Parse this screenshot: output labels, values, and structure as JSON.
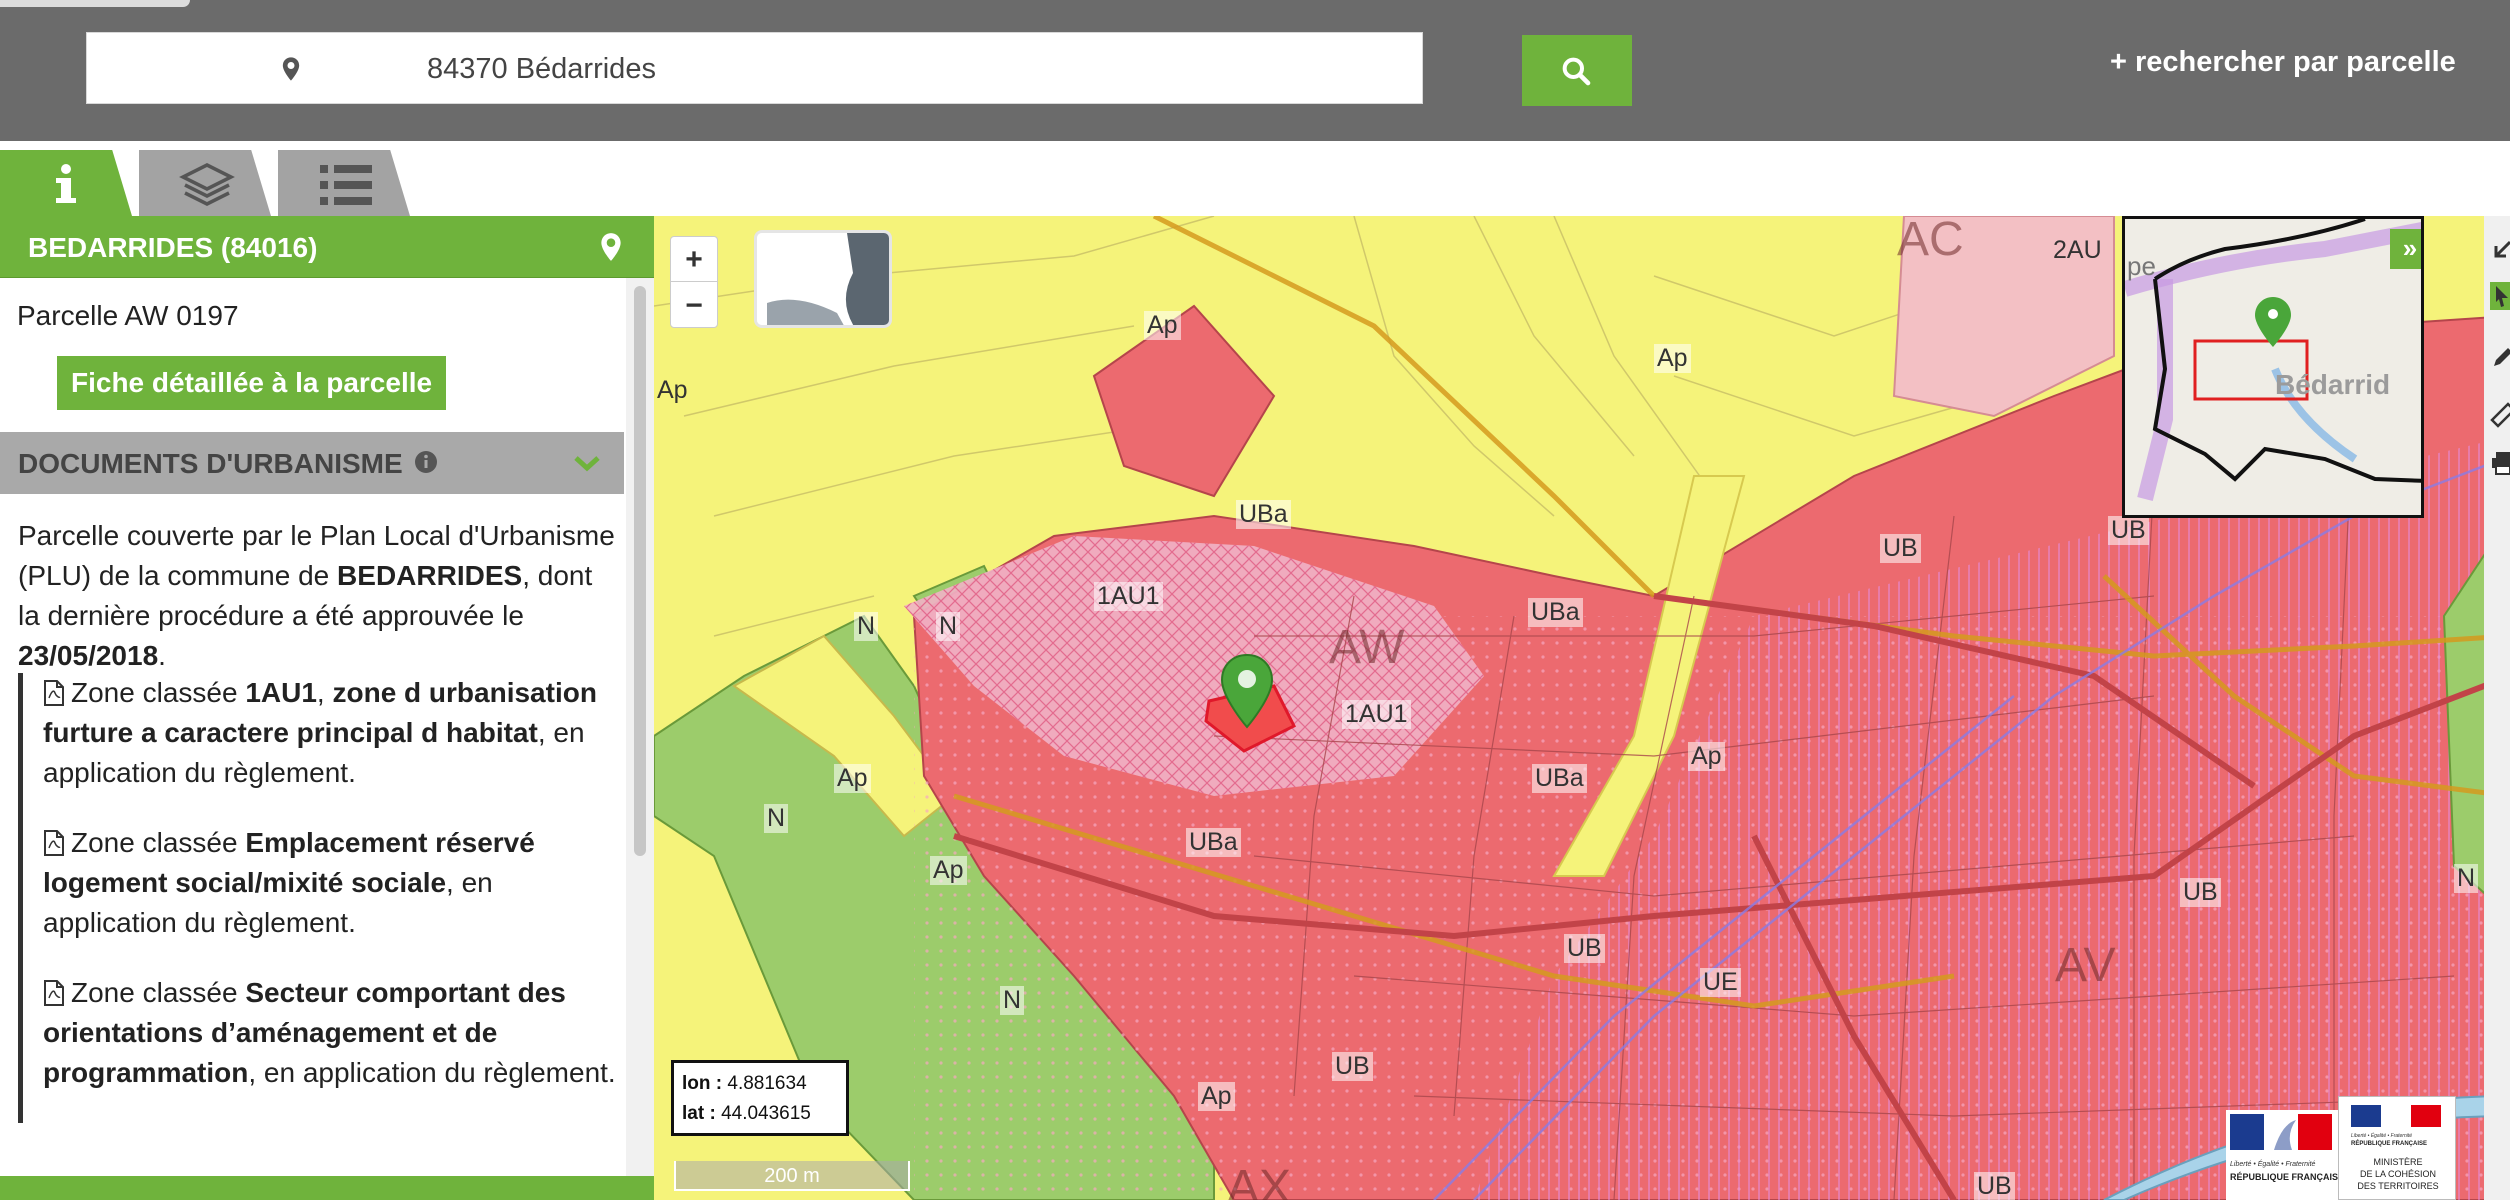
{
  "search": {
    "value": "84370 Bédarrides",
    "parcel_search_label": "+ rechercher par parcelle",
    "pin_icon": "map-marker",
    "button_icon": "magnifier"
  },
  "tabs": [
    {
      "name": "info",
      "icon": "info-i",
      "active": true
    },
    {
      "name": "layers",
      "icon": "layers-stack",
      "active": false
    },
    {
      "name": "legend",
      "icon": "list-lines",
      "active": false
    }
  ],
  "panel": {
    "commune_title": "BEDARRIDES (84016)",
    "parcel_id": "Parcelle AW 0197",
    "detail_button": "Fiche détaillée à la parcelle",
    "docs_title": "DOCUMENTS D'URBANISME",
    "intro": {
      "part1": "Parcelle couverte par le Plan Local d'Urbanisme (PLU) de la commune de ",
      "commune": "BEDARRIDES",
      "part2": ", dont la dernière procédure a été approuvée le ",
      "date": "23/05/2018",
      "part3": "."
    },
    "zones": [
      {
        "prefix": "Zone classée ",
        "name": "1AU1",
        "mid": ", ",
        "bold2": "zone d urbanisation furture a caractere principal d habitat",
        "suffix": ", en application du règlement."
      },
      {
        "prefix": "Zone classée ",
        "name": "Emplacement réservé logement social/mixité sociale",
        "mid": "",
        "bold2": "",
        "suffix": ", en application du règlement."
      },
      {
        "prefix": "Zone classée ",
        "name": "Secteur comportant des orientations d’aménagement et de programmation",
        "mid": "",
        "bold2": "",
        "suffix": ", en application du règlement."
      }
    ]
  },
  "map": {
    "zoom_in": "+",
    "zoom_out": "−",
    "coords": {
      "lon_label": "lon :",
      "lon": "4.881634",
      "lat_label": "lat :",
      "lat": "44.043615"
    },
    "scale": "200 m",
    "minimap_toggle": "»",
    "minimap_town": "Bédarrid",
    "minimap_label_pe": "pe",
    "labels": {
      "ap1": "Ap",
      "ap2": "Ap",
      "ap3": "Ap",
      "ap4": "Ap",
      "ap5": "Ap",
      "ap6": "Ap",
      "ap7": "Ap",
      "uba1": "UBa",
      "uba2": "UBa",
      "uba3": "UBa",
      "uba4": "UBa",
      "au1a": "1AU1",
      "au1b": "1AU1",
      "aw": "AW",
      "av": "AV",
      "ax": "AX",
      "ac": "AC",
      "n1": "N",
      "n2": "N",
      "n3": "N",
      "n4": "N",
      "n5": "N",
      "ub1": "UB",
      "ub2": "UB",
      "ub3": "UB",
      "ub4": "UB",
      "ub5": "UB",
      "ub6": "UB",
      "ue": "UE",
      "au2": "2AU"
    },
    "colors": {
      "ap": "#f5f37a",
      "u": "#ec6a6f",
      "n": "#9ccc6b",
      "au": "#f1b3c6"
    }
  },
  "logos": {
    "rf_line1": "Liberté • Égalité • Fraternité",
    "rf_line2": "RÉPUBLIQUE FRANÇAISE",
    "min_line1": "MINISTÈRE",
    "min_line2": "DE LA COHÉSION",
    "min_line3": "DES TERRITOIRES"
  }
}
